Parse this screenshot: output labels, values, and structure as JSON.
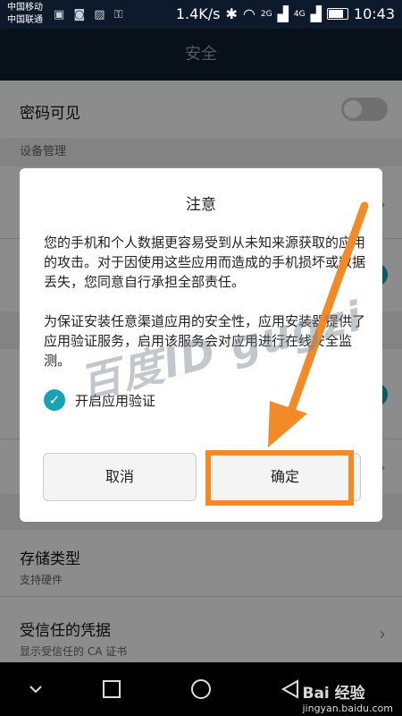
{
  "status_bar": {
    "carrier1": "中国移动",
    "carrier2": "中国联通",
    "net_speed": "1.4K/s",
    "sig1": "2G",
    "sig2": "4G",
    "time": "10:43"
  },
  "title": "安全",
  "settings": {
    "password_visible": "密码可见",
    "section_device": "设备管理",
    "storage_type": "存储类型",
    "storage_type_sub": "支持硬件",
    "trusted_credentials": "受信任的凭据",
    "trusted_credentials_sub": "显示受信任的 CA 证书"
  },
  "dialog": {
    "title": "注意",
    "paragraph1": "您的手机和个人数据更容易受到从未知来源获取的应用的攻击。对于因使用这些应用而造成的手机损坏或数据丢失，您同意自行承担全部责任。",
    "paragraph2": "为保证安装任意渠道应用的安全性，应用安装器提供了应用验证服务，启用该服务会对应用进行在线安全监测。",
    "checkbox_label": "开启应用验证",
    "checkbox_checked": true,
    "cancel_label": "取消",
    "confirm_label": "确定"
  },
  "watermark": {
    "overlay_text": "百度ID gugzi",
    "corner_text": "Bai 经验",
    "corner_url": "jingyan.baidu.com"
  },
  "colors": {
    "accent": "#19a2b3",
    "annotation": "#f28a27"
  }
}
